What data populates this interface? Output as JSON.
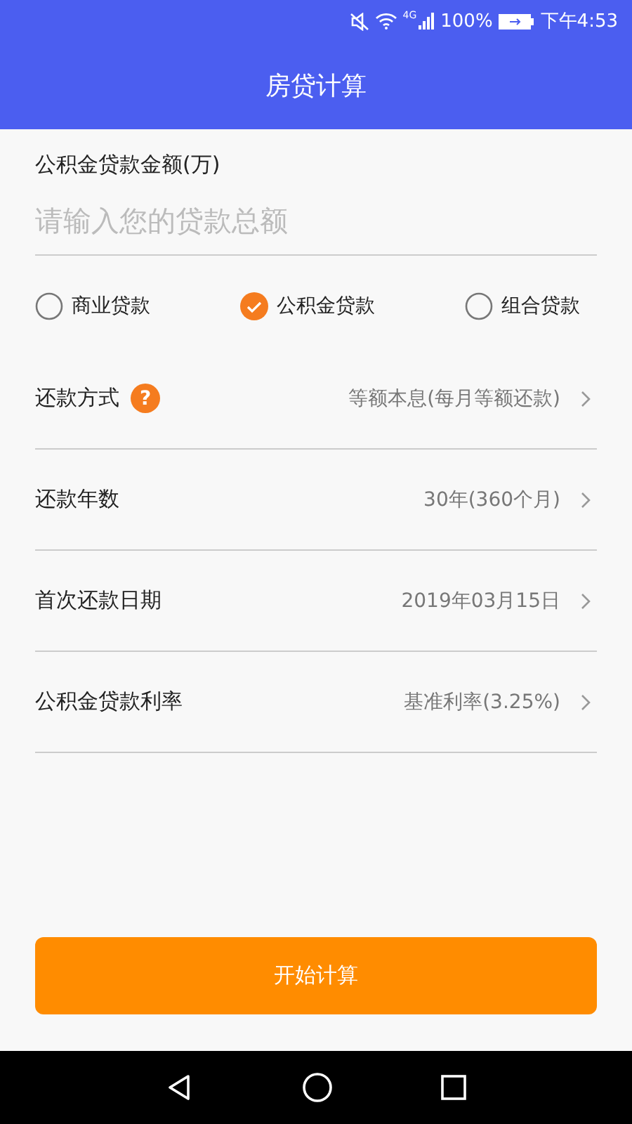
{
  "status_bar": {
    "network": "4G",
    "battery": "100%",
    "time": "下午4:53"
  },
  "header": {
    "title": "房贷计算"
  },
  "amount": {
    "label": "公积金贷款金额(万)",
    "placeholder": "请输入您的贷款总额"
  },
  "loan_types": [
    {
      "label": "商业贷款",
      "selected": false
    },
    {
      "label": "公积金贷款",
      "selected": true
    },
    {
      "label": "组合贷款",
      "selected": false
    }
  ],
  "rows": [
    {
      "label": "还款方式",
      "help": "?",
      "value": "等额本息(每月等额还款)"
    },
    {
      "label": "还款年数",
      "value": "30年(360个月)"
    },
    {
      "label": "首次还款日期",
      "value": "2019年03月15日"
    },
    {
      "label": "公积金贷款利率",
      "value": "基准利率(3.25%)"
    }
  ],
  "button": "开始计算"
}
